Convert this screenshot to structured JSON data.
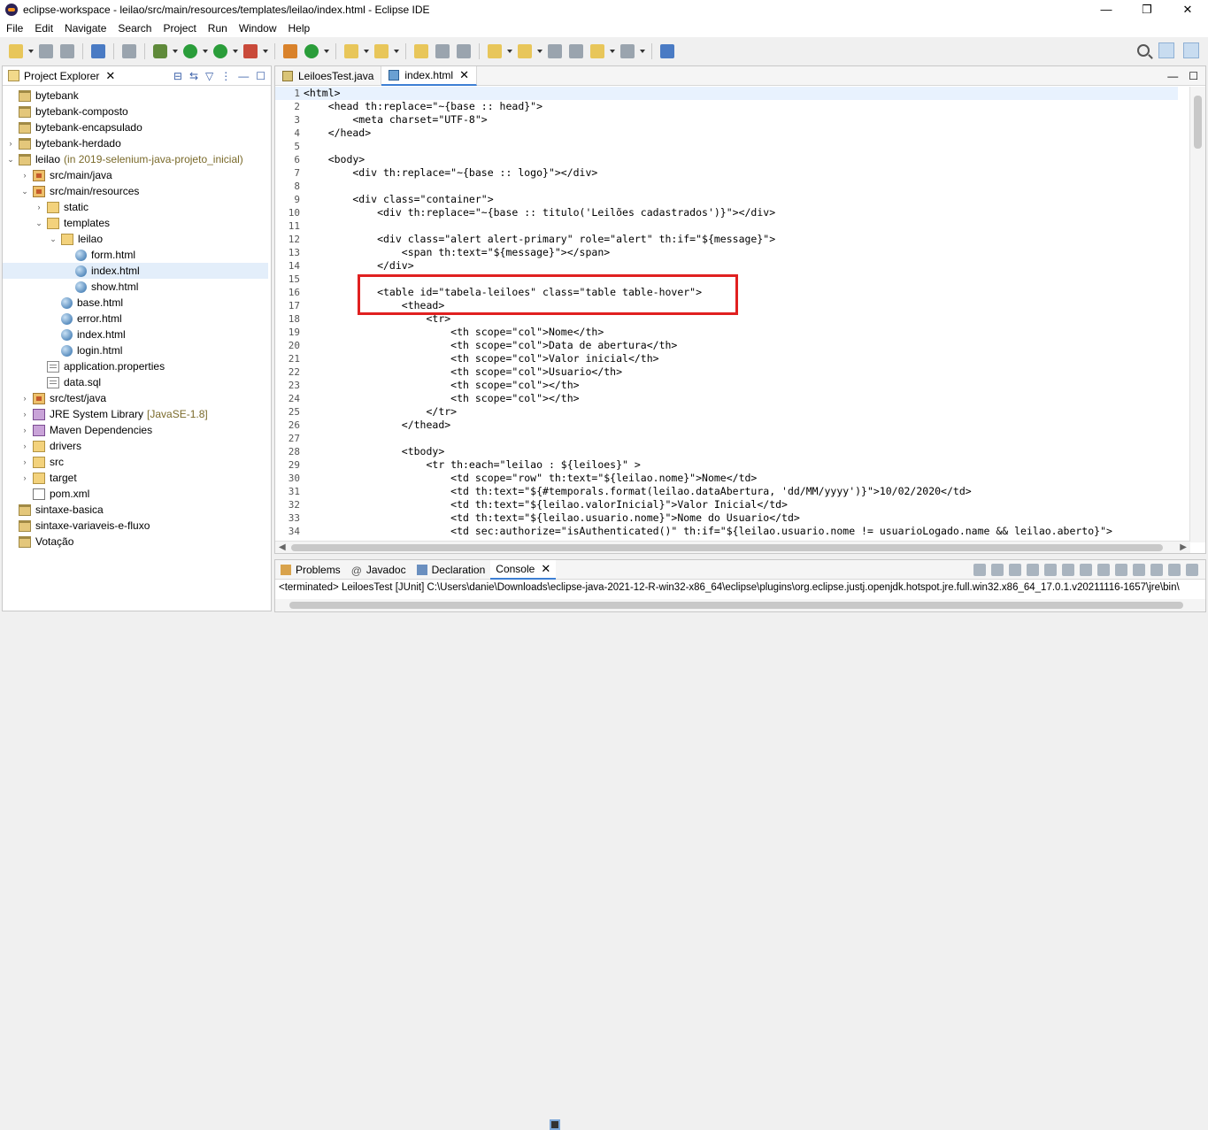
{
  "window": {
    "title": "eclipse-workspace - leilao/src/main/resources/templates/leilao/index.html - Eclipse IDE",
    "minimize": "—",
    "maximize": "❐",
    "close": "✕"
  },
  "menu": [
    "File",
    "Edit",
    "Navigate",
    "Search",
    "Project",
    "Run",
    "Window",
    "Help"
  ],
  "explorer": {
    "tab_label": "Project Explorer",
    "close": "✕",
    "items": [
      {
        "label": "bytebank",
        "icon": "project",
        "arrow": "",
        "depth": 0,
        "decor": ""
      },
      {
        "label": "bytebank-composto",
        "icon": "project",
        "arrow": "",
        "depth": 0,
        "decor": ""
      },
      {
        "label": "bytebank-encapsulado",
        "icon": "project",
        "arrow": "",
        "depth": 0,
        "decor": ""
      },
      {
        "label": "bytebank-herdado",
        "icon": "project",
        "arrow": "›",
        "depth": 0,
        "decor": ""
      },
      {
        "label": "leilao",
        "icon": "project",
        "arrow": "⌄",
        "depth": 0,
        "decor": "(in 2019-selenium-java-projeto_inicial)"
      },
      {
        "label": "src/main/java",
        "icon": "pkgfolder",
        "arrow": "›",
        "depth": 1,
        "decor": ""
      },
      {
        "label": "src/main/resources",
        "icon": "pkgfolder",
        "arrow": "⌄",
        "depth": 1,
        "decor": ""
      },
      {
        "label": "static",
        "icon": "folder",
        "arrow": "›",
        "depth": 2,
        "decor": ""
      },
      {
        "label": "templates",
        "icon": "folder",
        "arrow": "⌄",
        "depth": 2,
        "decor": ""
      },
      {
        "label": "leilao",
        "icon": "folder",
        "arrow": "⌄",
        "depth": 3,
        "decor": ""
      },
      {
        "label": "form.html",
        "icon": "html",
        "arrow": "",
        "depth": 4,
        "decor": ""
      },
      {
        "label": "index.html",
        "icon": "html",
        "arrow": "",
        "depth": 4,
        "decor": "",
        "selected": true
      },
      {
        "label": "show.html",
        "icon": "html",
        "arrow": "",
        "depth": 4,
        "decor": ""
      },
      {
        "label": "base.html",
        "icon": "html",
        "arrow": "",
        "depth": 3,
        "decor": ""
      },
      {
        "label": "error.html",
        "icon": "html",
        "arrow": "",
        "depth": 3,
        "decor": ""
      },
      {
        "label": "index.html",
        "icon": "html",
        "arrow": "",
        "depth": 3,
        "decor": ""
      },
      {
        "label": "login.html",
        "icon": "html",
        "arrow": "",
        "depth": 3,
        "decor": ""
      },
      {
        "label": "application.properties",
        "icon": "props",
        "arrow": "",
        "depth": 2,
        "decor": ""
      },
      {
        "label": "data.sql",
        "icon": "props",
        "arrow": "",
        "depth": 2,
        "decor": ""
      },
      {
        "label": "src/test/java",
        "icon": "pkgfolder",
        "arrow": "›",
        "depth": 1,
        "decor": ""
      },
      {
        "label": "JRE System Library",
        "icon": "lib",
        "arrow": "›",
        "depth": 1,
        "decor": "[JavaSE-1.8]"
      },
      {
        "label": "Maven Dependencies",
        "icon": "lib",
        "arrow": "›",
        "depth": 1,
        "decor": ""
      },
      {
        "label": "drivers",
        "icon": "folder",
        "arrow": "›",
        "depth": 1,
        "decor": ""
      },
      {
        "label": "src",
        "icon": "folder",
        "arrow": "›",
        "depth": 1,
        "decor": ""
      },
      {
        "label": "target",
        "icon": "folder",
        "arrow": "›",
        "depth": 1,
        "decor": ""
      },
      {
        "label": "pom.xml",
        "icon": "xmlfile",
        "arrow": "",
        "depth": 1,
        "decor": ""
      },
      {
        "label": "sintaxe-basica",
        "icon": "project",
        "arrow": "",
        "depth": 0,
        "decor": ""
      },
      {
        "label": "sintaxe-variaveis-e-fluxo",
        "icon": "project",
        "arrow": "",
        "depth": 0,
        "decor": ""
      },
      {
        "label": "Votação",
        "icon": "project",
        "arrow": "",
        "depth": 0,
        "decor": ""
      }
    ]
  },
  "editor": {
    "tabs": [
      {
        "label": "LeiloesTest.java",
        "type": "java",
        "active": false
      },
      {
        "label": "index.html",
        "type": "html",
        "active": true
      }
    ],
    "close": "✕",
    "lines": [
      "<html>",
      "    <head th:replace=\"~{base :: head}\">",
      "        <meta charset=\"UTF-8\">",
      "    </head>",
      "",
      "    <body>",
      "        <div th:replace=\"~{base :: logo}\"></div>",
      "",
      "        <div class=\"container\">",
      "            <div th:replace=\"~{base :: titulo('Leilões cadastrados')}\"></div>",
      "",
      "            <div class=\"alert alert-primary\" role=\"alert\" th:if=\"${message}\">",
      "                <span th:text=\"${message}\"></span>",
      "            </div>",
      "",
      "            <table id=\"tabela-leiloes\" class=\"table table-hover\">",
      "                <thead>",
      "                    <tr>",
      "                        <th scope=\"col\">Nome</th>",
      "                        <th scope=\"col\">Data de abertura</th>",
      "                        <th scope=\"col\">Valor inicial</th>",
      "                        <th scope=\"col\">Usuario</th>",
      "                        <th scope=\"col\"></th>",
      "                        <th scope=\"col\"></th>",
      "                    </tr>",
      "                </thead>",
      "",
      "                <tbody>",
      "                    <tr th:each=\"leilao : ${leiloes}\" >",
      "                        <td scope=\"row\" th:text=\"${leilao.nome}\">Nome</td>",
      "                        <td th:text=\"${#temporals.format(leilao.dataAbertura, 'dd/MM/yyyy')}\">10/02/2020</td>",
      "                        <td th:text=\"${leilao.valorInicial}\">Valor Inicial</td>",
      "                        <td th:text=\"${leilao.usuario.nome}\">Nome do Usuario</td>",
      "                        <td sec:authorize=\"isAuthenticated()\" th:if=\"${leilao.usuario.nome != usuarioLogado.name && leilao.aberto}\">"
    ]
  },
  "console": {
    "tabs": [
      {
        "label": "Problems",
        "icon": "problems",
        "active": false
      },
      {
        "label": "Javadoc",
        "icon": "javadoc",
        "active": false
      },
      {
        "label": "Declaration",
        "icon": "decl",
        "active": false
      },
      {
        "label": "Console",
        "icon": "console",
        "active": true
      }
    ],
    "status": "<terminated> LeiloesTest [JUnit] C:\\Users\\danie\\Downloads\\eclipse-java-2021-12-R-win32-x86_64\\eclipse\\plugins\\org.eclipse.justj.openjdk.hotspot.jre.full.win32.x86_64_17.0.1.v20211116-1657\\jre\\bin\\"
  },
  "colors": {
    "highlight_border": "#e02020",
    "selection": "#e3eefa",
    "active_tab": "#3d7fd4"
  }
}
